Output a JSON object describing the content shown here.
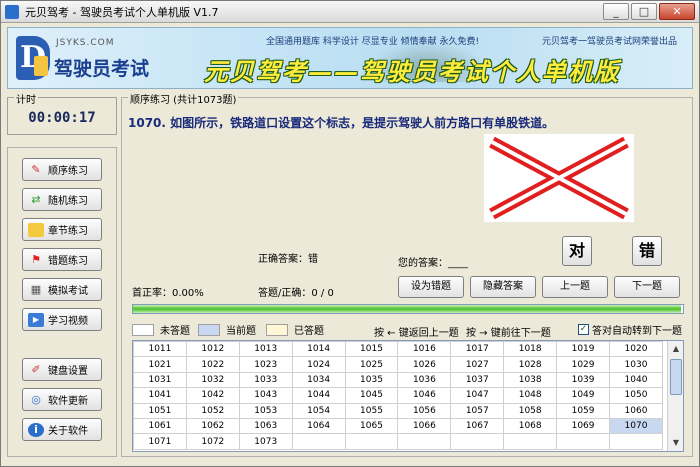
{
  "window": {
    "title": "元贝驾考 - 驾驶员考试个人单机版 V1.7"
  },
  "banner": {
    "site": "JSYKS.COM",
    "logo_name": "驾驶员考试",
    "slogan_top": "全国通用题库 科学设计 尽显专业 倾情奉献 永久免费!",
    "slogan_right": "元贝驾考一驾驶员考试网荣誉出品",
    "title": "元贝驾考——驾驶员考试个人单机版"
  },
  "timer": {
    "label": "计时",
    "value": "00:00:17"
  },
  "sidebar": {
    "items": [
      {
        "label": "顺序练习",
        "icon": "edit-icon"
      },
      {
        "label": "随机练习",
        "icon": "refresh-icon"
      },
      {
        "label": "章节练习",
        "icon": "folder-icon"
      },
      {
        "label": "错题练习",
        "icon": "flag-icon"
      },
      {
        "label": "模拟考试",
        "icon": "grid-icon"
      },
      {
        "label": "学习视频",
        "icon": "video-icon"
      },
      {
        "label": "键盘设置",
        "icon": "pen-icon"
      },
      {
        "label": "软件更新",
        "icon": "globe-icon"
      },
      {
        "label": "关于软件",
        "icon": "info-icon"
      }
    ]
  },
  "main": {
    "section_label": "顺序练习 (共计1073题)",
    "question": "1070. 如图所示，铁路道口设置这个标志，是提示驾驶人前方路口有单股铁道。",
    "correct_answer": "正确答案：错",
    "your_answer": "您的答案：____",
    "true_label": "对",
    "false_label": "错",
    "accuracy": "首正率：0.00%",
    "answered": "答题/正确：0 / 0",
    "set_wrong": "设为错题",
    "hide_answer": "隐藏答案",
    "prev": "上一题",
    "next": "下一题",
    "progress": 0.997
  },
  "legend": {
    "unanswered": "未答题",
    "current": "当前题",
    "answered": "已答题",
    "hint_prev": "按 ← 键返回上一题",
    "hint_next": "按 → 键前往下一题",
    "auto_next": "答对自动转到下一题",
    "colors": {
      "unanswered": "#ffffff",
      "current": "#c8d8f0",
      "answered": "#fff7d6"
    }
  },
  "grid_rows": [
    [
      "1011",
      "1012",
      "1013",
      "1014",
      "1015",
      "1016",
      "1017",
      "1018",
      "1019",
      "1020"
    ],
    [
      "1021",
      "1022",
      "1023",
      "1024",
      "1025",
      "1026",
      "1027",
      "1028",
      "1029",
      "1030"
    ],
    [
      "1031",
      "1032",
      "1033",
      "1034",
      "1035",
      "1036",
      "1037",
      "1038",
      "1039",
      "1040"
    ],
    [
      "1041",
      "1042",
      "1043",
      "1044",
      "1045",
      "1046",
      "1047",
      "1048",
      "1049",
      "1050"
    ],
    [
      "1051",
      "1052",
      "1053",
      "1054",
      "1055",
      "1056",
      "1057",
      "1058",
      "1059",
      "1060"
    ],
    [
      "1061",
      "1062",
      "1063",
      "1064",
      "1065",
      "1066",
      "1067",
      "1068",
      "1069",
      "1070"
    ],
    [
      "1071",
      "1072",
      "1073",
      "",
      "",
      "",
      "",
      "",
      "",
      ""
    ]
  ]
}
